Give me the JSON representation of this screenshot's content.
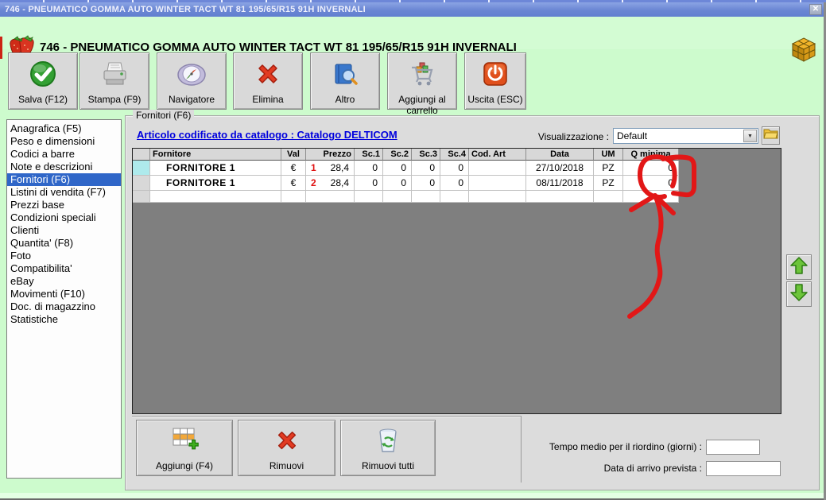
{
  "title": "746 - PNEUMATICO GOMMA AUTO WINTER TACT WT 81 195/65/R15 91H INVERNALI",
  "titlebar": {
    "close_glyph": "✕"
  },
  "toolbar": {
    "buttons": [
      {
        "label": "Salva (F12)",
        "icon": "save-check-icon"
      },
      {
        "label": "Stampa (F9)",
        "icon": "printer-icon"
      },
      {
        "label": "Navigatore",
        "icon": "compass-icon"
      },
      {
        "label": "Elimina",
        "icon": "red-x-icon"
      },
      {
        "label": "Altro",
        "icon": "book-search-icon"
      },
      {
        "label": "Aggiungi al carrello",
        "icon": "cart-icon"
      },
      {
        "label": "Uscita (ESC)",
        "icon": "power-icon"
      }
    ]
  },
  "sidebar": {
    "items": [
      "Anagrafica (F5)",
      "Peso e dimensioni",
      "Codici a barre",
      "Note e descrizioni",
      "Fornitori (F6)",
      "Listini di vendita (F7)",
      "Prezzi base",
      "Condizioni speciali",
      "Clienti",
      "Quantita' (F8)",
      "Foto",
      "Compatibilita'",
      "eBay",
      "Movimenti (F10)",
      "Doc. di magazzino",
      "Statistiche"
    ],
    "selected": "Fornitori (F6)"
  },
  "panel": {
    "title": "Fornitori (F6)",
    "catalog_link": "Articolo codificato da catalogo : Catalogo DELTICOM",
    "view_label": "Visualizzazione :",
    "view_value": "Default",
    "dropdown_glyph": "▼"
  },
  "table": {
    "headers": [
      "Fornitore",
      "Val",
      "Prezzo",
      "Sc.1",
      "Sc.2",
      "Sc.3",
      "Sc.4",
      "Cod. Art",
      "Data",
      "UM",
      "Q minima"
    ],
    "rows": [
      {
        "fornitore": "FORNITORE 1",
        "val": "€",
        "num": "1",
        "prezzo": "28,4",
        "sc1": "0",
        "sc2": "0",
        "sc3": "0",
        "sc4": "0",
        "cod_art": "",
        "data": "27/10/2018",
        "um": "PZ",
        "q_minima": "0"
      },
      {
        "fornitore": "FORNITORE 1",
        "val": "€",
        "num": "2",
        "prezzo": "28,4",
        "sc1": "0",
        "sc2": "0",
        "sc3": "0",
        "sc4": "0",
        "cod_art": "",
        "data": "08/11/2018",
        "um": "PZ",
        "q_minima": "0"
      }
    ]
  },
  "footer": {
    "buttons": [
      {
        "label": "Aggiungi (F4)",
        "icon": "add-table-icon"
      },
      {
        "label": "Rimuovi",
        "icon": "red-x-icon"
      },
      {
        "label": "Rimuovi tutti",
        "icon": "recycle-bin-icon"
      }
    ],
    "fields": [
      {
        "label": "Tempo medio per il riordino (giorni) :",
        "value": ""
      },
      {
        "label": "Data di arrivo prevista :",
        "value": ""
      }
    ]
  },
  "colors": {
    "window_background": "#cdfbcd",
    "titlebar_blue": "#6e89d5",
    "selection_blue": "#2f66c8",
    "link_blue": "#0000dd",
    "grid_background": "#7f7f7f",
    "row_marker_cyan": "#aeeaec",
    "price_number_red": "#e01212",
    "annotation": "#e21717"
  }
}
